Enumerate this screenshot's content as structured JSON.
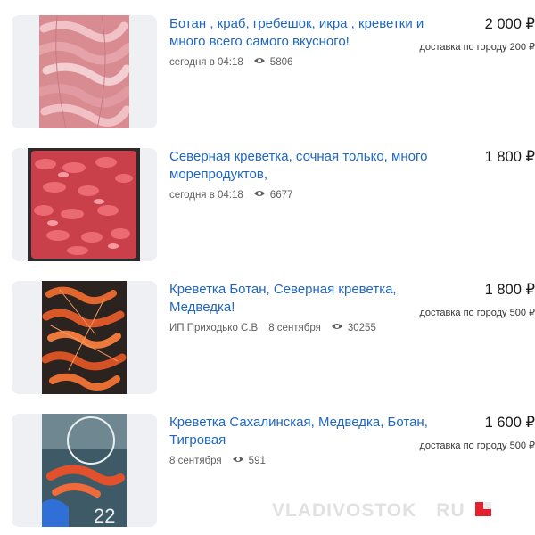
{
  "listings": [
    {
      "title": "Ботан , краб, гребешок, икра , креветки и много всего самого вкусного!",
      "seller": "",
      "date": "сегодня в 04:18",
      "views": "5806",
      "price": "2 000 ₽",
      "delivery": "доставка по городу 200 ₽"
    },
    {
      "title": "Северная креветка, сочная только, много морепродуктов,",
      "seller": "",
      "date": "сегодня в 04:18",
      "views": "6677",
      "price": "1 800 ₽",
      "delivery": ""
    },
    {
      "title": "Креветка Ботан, Северная креветка, Медведка!",
      "seller": "ИП Приходько С.В",
      "date": "8 сентября",
      "views": "30255",
      "price": "1 800 ₽",
      "delivery": "доставка по городу 500 ₽"
    },
    {
      "title": "Креветка Сахалинская, Медведка, Ботан, Тигровая",
      "seller": "",
      "date": "8 сентября",
      "views": "591",
      "price": "1 600 ₽",
      "delivery": "доставка по городу 500 ₽"
    }
  ],
  "icons": {
    "views": "eye-icon"
  },
  "colors": {
    "title_link": "#1f66c2",
    "thumb_bg": "#eef0f3",
    "watermark_accent": "#e3202b"
  },
  "watermark": {
    "text": "VLADIVOSTOK",
    "suffix": "RU"
  }
}
